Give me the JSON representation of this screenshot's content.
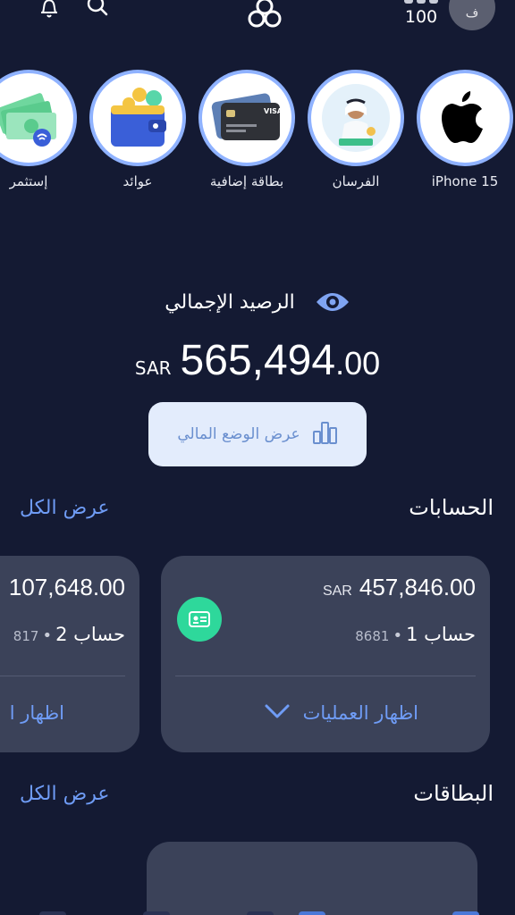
{
  "header": {
    "points_value": "100",
    "avatar_initial": "ف",
    "icons": [
      "bell-icon",
      "search-icon",
      "app-logo-icon"
    ]
  },
  "stories": [
    {
      "label": "iPhone 15",
      "icon": "apple-logo"
    },
    {
      "label": "الفرسان",
      "icon": "alfursan-illustration"
    },
    {
      "label": "بطاقة إضافية",
      "icon": "credit-cards-illustration"
    },
    {
      "label": "عوائد",
      "icon": "wallet-coins-illustration"
    },
    {
      "label": "إستثمر",
      "icon": "cash-stack-illustration"
    }
  ],
  "balance": {
    "label": "الرصيد الإجمالي",
    "currency": "SAR",
    "amount_int": "565,494",
    "amount_dec": ".00",
    "financial_button": "عرض الوضع المالي"
  },
  "accounts_section": {
    "title": "الحسابات",
    "view_all": "عرض الكل",
    "accounts": [
      {
        "currency": "SAR",
        "amount": "457,846.00",
        "name": "حساب 1",
        "separator": "•",
        "number": "8681",
        "action": "اظهار العمليات"
      },
      {
        "amount": "107,648.00",
        "name": "حساب 2",
        "separator": "•",
        "number": "817",
        "action": "اظهار ا"
      }
    ]
  },
  "cards_section": {
    "title": "البطاقات",
    "view_all": "عرض الكل"
  },
  "colors": {
    "background": "#141a33",
    "card": "#3b4259",
    "accent": "#6f9cf6",
    "story_ring": "#8fb2ff",
    "badge": "#2ed89b"
  }
}
